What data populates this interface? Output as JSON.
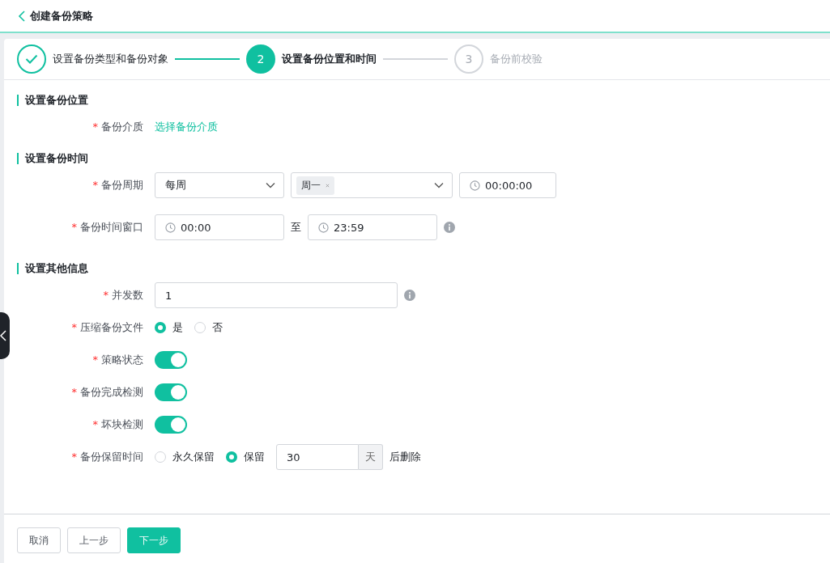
{
  "header": {
    "title": "创建备份策略"
  },
  "steps": [
    {
      "label": "设置备份类型和备份对象",
      "done": true,
      "selected": false
    },
    {
      "number": "2",
      "label": "设置备份位置和时间",
      "done": false,
      "selected": true
    },
    {
      "number": "3",
      "label": "备份前校验",
      "done": false,
      "selected": false
    }
  ],
  "sections": [
    {
      "title": "设置备份位置",
      "rows": [
        {
          "kind": "link",
          "label": "备份介质",
          "marker": "*",
          "value": "选择备份介质"
        }
      ]
    },
    {
      "title": "设置备份时间",
      "rows": [
        {
          "kind": "schedule",
          "label": "备份周期",
          "marker": "*",
          "period": "每周",
          "tags": [
            "周一"
          ],
          "time": "00:00:00"
        },
        {
          "kind": "range",
          "label": "备份时间窗口",
          "marker": "*",
          "from": "00:00",
          "separator": "至",
          "to": "23:59",
          "info": true
        }
      ]
    },
    {
      "title": "设置其他信息",
      "rows": [
        {
          "kind": "input",
          "label": "并发数",
          "marker": "*",
          "value": "1",
          "info": true
        },
        {
          "kind": "radio",
          "label": "压缩备份文件",
          "marker": "*",
          "options": [
            {
              "label": "是",
              "selected": true
            },
            {
              "label": "否",
              "selected": false
            }
          ]
        },
        {
          "kind": "switch",
          "label": "策略状态",
          "marker": "*",
          "on": true
        },
        {
          "kind": "switch",
          "label": "备份完成检测",
          "marker": "*",
          "on": true
        },
        {
          "kind": "switch",
          "label": "坏块检测",
          "marker": "*",
          "on": true
        },
        {
          "kind": "retention",
          "label": "备份保留时间",
          "marker": "*",
          "options": [
            {
              "label": "永久保留",
              "selected": false
            },
            {
              "label": "保留",
              "selected": true
            }
          ],
          "value": "30",
          "unit": "天",
          "suffix": "后删除"
        }
      ]
    }
  ],
  "buttons": [
    {
      "label": "取消",
      "primary": false
    },
    {
      "label": "上一步",
      "primary": false
    },
    {
      "label": "下一步",
      "primary": true
    }
  ]
}
